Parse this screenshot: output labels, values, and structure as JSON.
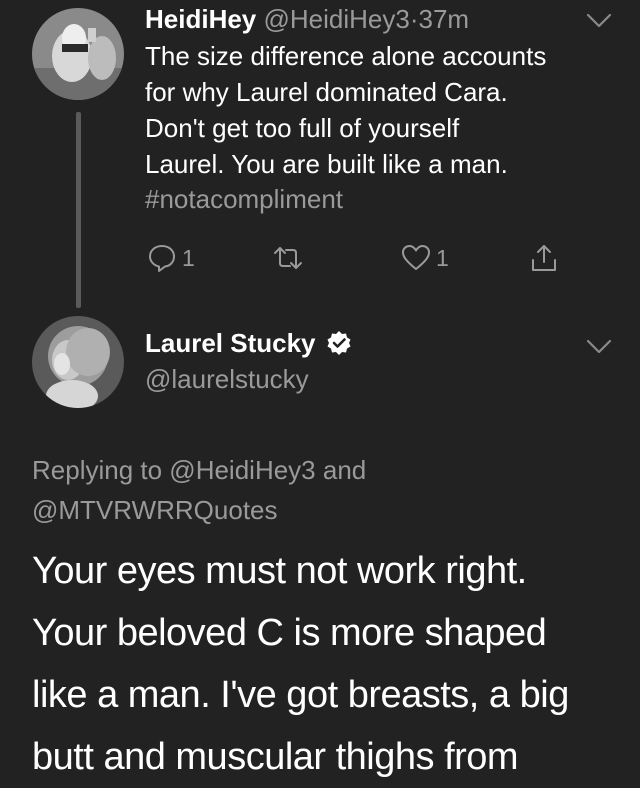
{
  "parent_tweet": {
    "display_name": "HeidiHey",
    "handle": "@HeidiHey3",
    "separator": "·",
    "time": "37m",
    "text_lines": [
      "The size difference alone accounts",
      "for why Laurel dominated Cara.",
      "Don't get too full of yourself",
      "Laurel. You are built like a man."
    ],
    "hashtag": "#notacompliment",
    "actions": {
      "reply_count": "1",
      "retweet_count": "",
      "like_count": "1"
    },
    "icons": {
      "menu": "chevron-down-icon",
      "reply": "reply-icon",
      "retweet": "retweet-icon",
      "like": "heart-icon",
      "share": "share-icon"
    }
  },
  "reply_tweet": {
    "display_name": "Laurel Stucky",
    "handle": "@laurelstucky",
    "verified_icon": "verified-badge-icon",
    "replying_lines": [
      "Replying to @HeidiHey3 and",
      "@MTVRWRRQuotes"
    ],
    "text_lines": [
      "Your eyes must not work right.",
      "Your beloved C is more shaped",
      "like a man. I've got breasts, a big",
      "butt and muscular thighs from"
    ]
  },
  "colors": {
    "background": "#222222",
    "primary_text": "#ffffff",
    "secondary_text": "#9a9a9a",
    "thread_line": "#5a5a5a"
  }
}
